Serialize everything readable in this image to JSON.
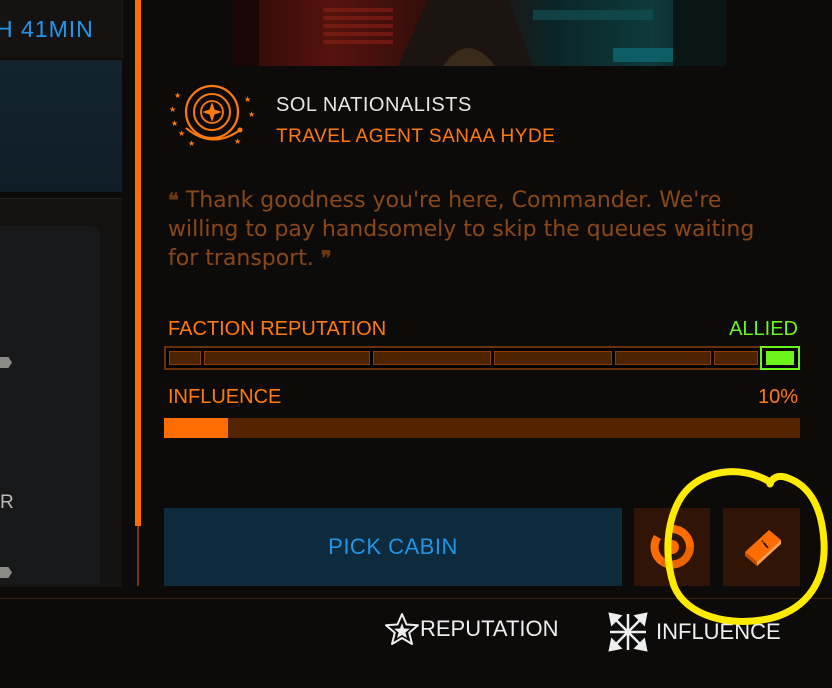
{
  "timer": {
    "text": "H 41MIN"
  },
  "left_fragment": "R",
  "faction": {
    "name": "SOL NATIONALISTS",
    "agent": "TRAVEL AGENT SANAA HYDE",
    "logo_icon": "faction-emblem-icon"
  },
  "quote": {
    "open_mark": "❝",
    "text": "Thank goodness you're here, Commander. We're willing to pay handsomely to skip the queues waiting for transport.",
    "close_mark": "❞"
  },
  "reputation": {
    "label": "FACTION REPUTATION",
    "status": "ALLIED",
    "status_color": "#6cf51b",
    "level_index": 6,
    "levels": 7
  },
  "influence": {
    "label": "INFLUENCE",
    "value_text": "10%",
    "value": 0.1,
    "fill_color": "#ff6d00"
  },
  "buttons": {
    "pick_cabin": "PICK CABIN",
    "faction_icon": "faction-swirl-icon",
    "info_icon": "info-book-icon"
  },
  "legend": {
    "reputation": "REPUTATION",
    "reputation_icon": "star-icon",
    "influence": "INFLUENCE",
    "influence_icon": "expand-arrows-icon"
  },
  "colors": {
    "accent": "#ff6d00",
    "blue": "#1f95e8",
    "annotation": "#ffeb00"
  }
}
